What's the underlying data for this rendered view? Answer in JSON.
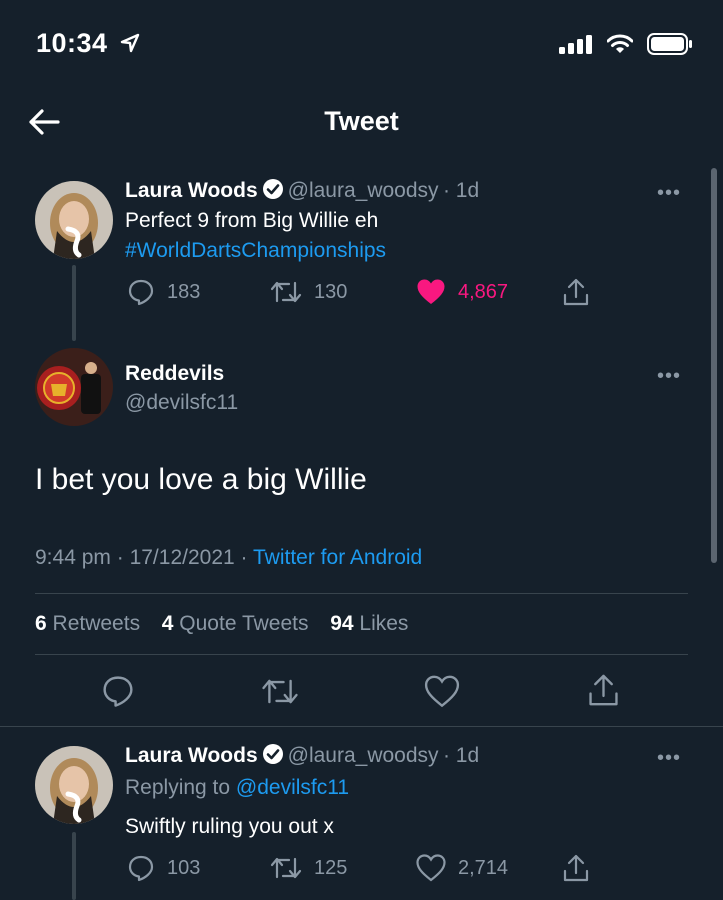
{
  "status_bar": {
    "time": "10:34"
  },
  "header": {
    "title": "Tweet"
  },
  "parent_tweet": {
    "name": "Laura Woods",
    "handle": "@laura_woodsy",
    "age": "· 1d",
    "text": "Perfect 9 from Big Willie eh",
    "hashtag": "#WorldDartsChampionships",
    "replies": "183",
    "retweets": "130",
    "likes": "4,867",
    "more": "•••"
  },
  "main_tweet": {
    "name": "Reddevils",
    "handle": "@devilsfc11",
    "text": "I bet you love a big Willie",
    "time": "9:44 pm",
    "date": "17/12/2021",
    "source": "Twitter for Android",
    "sep1": "·",
    "sep2": "·",
    "more": "•••",
    "stats": {
      "retweets_count": "6",
      "retweets_label": "Retweets",
      "quotes_count": "4",
      "quotes_label": "Quote Tweets",
      "likes_count": "94",
      "likes_label": "Likes"
    }
  },
  "reply_tweet": {
    "name": "Laura Woods",
    "handle": "@laura_woodsy",
    "age": "· 1d",
    "replying_prefix": "Replying to",
    "replying_to": "@devilsfc11",
    "text": "Swiftly ruling you out x",
    "replies": "103",
    "retweets": "125",
    "likes": "2,714",
    "more": "•••"
  },
  "colors": {
    "background": "#15202b",
    "accent": "#1d9bf0",
    "like": "#f91880",
    "muted": "#8b98a5",
    "divider": "#38444d"
  }
}
